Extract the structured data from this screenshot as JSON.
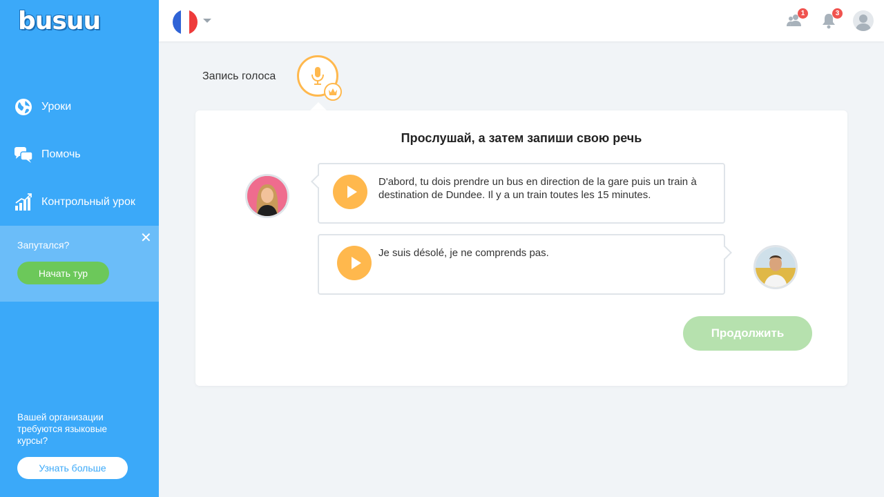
{
  "app": {
    "logo": "busuu"
  },
  "sidebar": {
    "items": [
      {
        "label": "Уроки",
        "icon": "globe-icon"
      },
      {
        "label": "Помочь",
        "icon": "chat-bubbles-icon"
      },
      {
        "label": "Контрольный урок",
        "icon": "bar-chart-icon"
      }
    ],
    "tour": {
      "question": "Запутался?",
      "button": "Начать тур",
      "close": "✕"
    },
    "org": {
      "text": "Вашей организации требуются языковые курсы?",
      "button": "Узнать больше"
    }
  },
  "topbar": {
    "language_flag": "france-flag",
    "friends_badge": "1",
    "notifications_badge": "3"
  },
  "exercise": {
    "type_label": "Запись голоса",
    "instruction": "Прослушай, а затем запиши свою речь",
    "dialogue": [
      {
        "speaker": "female-speaker",
        "text": "D'abord, tu dois prendre un bus en direction de la gare puis un train à destination de Dundee. Il y a un train toutes les 15 minutes."
      },
      {
        "speaker": "male-speaker",
        "text": "Je suis désolé, je ne comprends pas."
      }
    ],
    "continue_label": "Продолжить"
  },
  "colors": {
    "sidebar": "#3ba9f9",
    "accent_orange": "#ffb84d",
    "green_button": "#6cc85a",
    "continue_disabled": "#b6e1ae",
    "badge": "#f0534f"
  }
}
